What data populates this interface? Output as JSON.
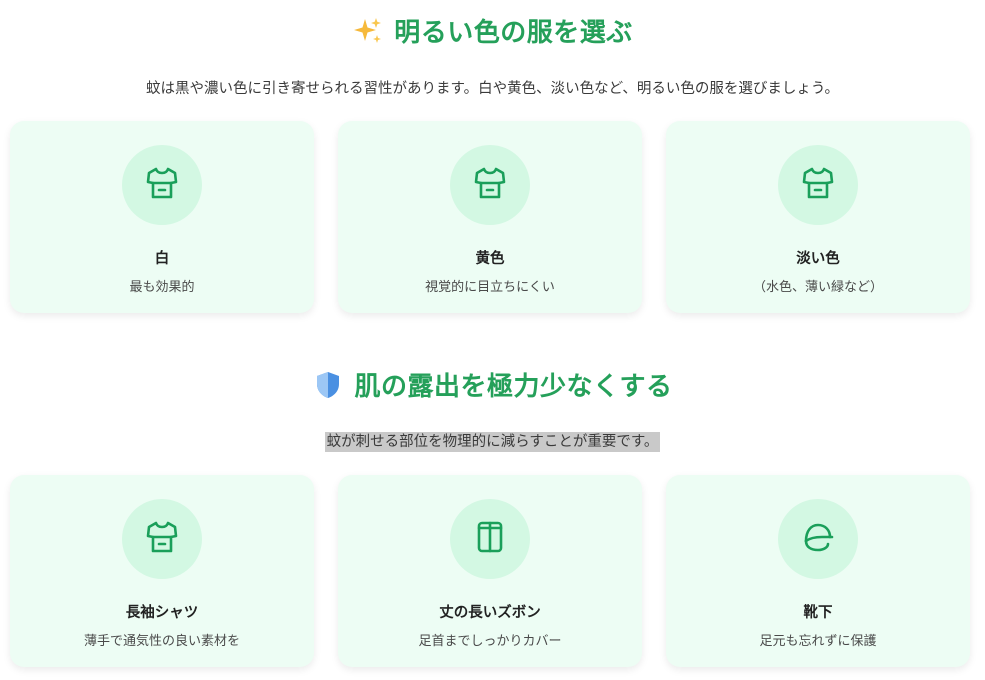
{
  "colors": {
    "accent": "#25a05a",
    "card_bg": "#edfdf4",
    "icon_bg": "#d3f8e3",
    "icon_stroke": "#1a9f5a"
  },
  "section1": {
    "title": "明るい色の服を選ぶ",
    "emoji": "sparkles-icon",
    "description": "蚊は黒や濃い色に引き寄せられる習性があります。白や黄色、淡い色など、明るい色の服を選びましょう。",
    "cards": [
      {
        "icon": "shirt-icon",
        "title": "白",
        "subtitle": "最も効果的"
      },
      {
        "icon": "shirt-icon",
        "title": "黄色",
        "subtitle": "視覚的に目立ちにくい"
      },
      {
        "icon": "shirt-icon",
        "title": "淡い色",
        "subtitle": "（水色、薄い緑など）"
      }
    ]
  },
  "section2": {
    "title": "肌の露出を極力少なくする",
    "emoji": "shield-icon",
    "description": "蚊が刺せる部位を物理的に減らすことが重要です。",
    "cards": [
      {
        "icon": "shirt-icon",
        "title": "長袖シャツ",
        "subtitle": "薄手で通気性の良い素材を"
      },
      {
        "icon": "pants-icon",
        "title": "丈の長いズボン",
        "subtitle": "足首までしっかりカバー"
      },
      {
        "icon": "cap-icon",
        "title": "靴下",
        "subtitle": "足元も忘れずに保護"
      }
    ]
  }
}
